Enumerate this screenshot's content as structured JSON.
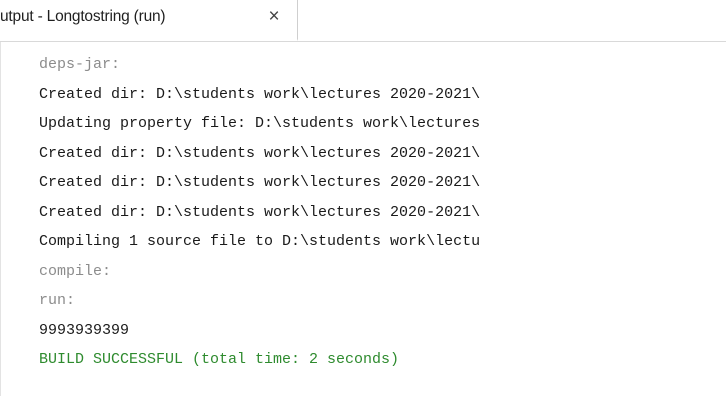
{
  "tab": {
    "title": "utput - Longtostring (run)",
    "close_glyph": "×",
    "close_icon": "close-icon"
  },
  "output": {
    "lines": [
      {
        "text": "deps-jar:",
        "kind": "muted"
      },
      {
        "text": "Created dir: D:\\students work\\lectures 2020-2021\\",
        "kind": "normal"
      },
      {
        "text": "Updating property file: D:\\students work\\lectures",
        "kind": "normal"
      },
      {
        "text": "Created dir: D:\\students work\\lectures 2020-2021\\",
        "kind": "normal"
      },
      {
        "text": "Created dir: D:\\students work\\lectures 2020-2021\\",
        "kind": "normal"
      },
      {
        "text": "Created dir: D:\\students work\\lectures 2020-2021\\",
        "kind": "normal"
      },
      {
        "text": "Compiling 1 source file to D:\\students work\\lectu",
        "kind": "normal"
      },
      {
        "text": "compile:",
        "kind": "muted"
      },
      {
        "text": "run:",
        "kind": "muted"
      },
      {
        "text": "9993939399",
        "kind": "normal"
      },
      {
        "text": "BUILD SUCCESSFUL (total time: 2 seconds)",
        "kind": "success"
      }
    ]
  },
  "colors": {
    "normal_text": "#1a1a1a",
    "muted_text": "#8c8c8c",
    "success_text": "#2e8b2e"
  }
}
